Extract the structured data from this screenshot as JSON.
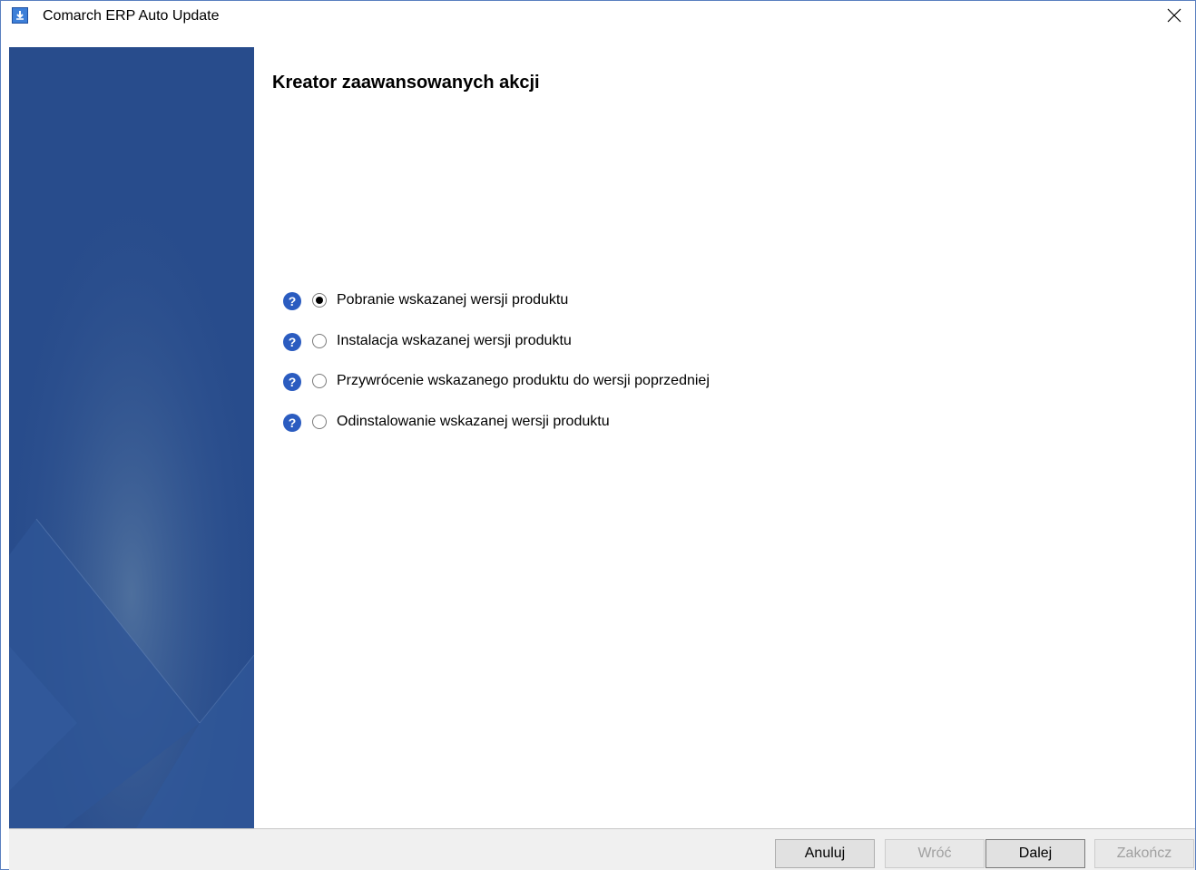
{
  "window": {
    "title": "Comarch ERP Auto Update"
  },
  "wizard": {
    "heading": "Kreator zaawansowanych akcji",
    "options": [
      {
        "label": "Pobranie wskazanej wersji produktu",
        "checked": true
      },
      {
        "label": "Instalacja wskazanej wersji produktu",
        "checked": false
      },
      {
        "label": "Przywrócenie wskazanego produktu do wersji poprzedniej",
        "checked": false
      },
      {
        "label": "Odinstalowanie wskazanej wersji produktu",
        "checked": false
      }
    ]
  },
  "buttons": {
    "cancel": "Anuluj",
    "back": "Wróć",
    "next": "Dalej",
    "finish": "Zakończ"
  },
  "icons": {
    "app": "download-arrow-icon",
    "close": "close-icon",
    "help": "help-question-icon"
  },
  "colors": {
    "sidebar": "#284c8c",
    "help_icon": "#2b5cc0"
  }
}
